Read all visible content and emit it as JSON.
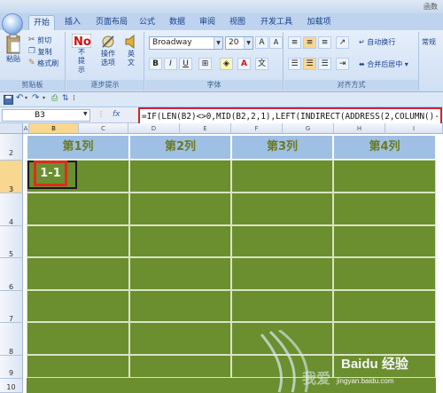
{
  "window": {
    "title_right": "函数"
  },
  "tabs": [
    {
      "label": "开始"
    },
    {
      "label": "插入"
    },
    {
      "label": "页面布局"
    },
    {
      "label": "公式"
    },
    {
      "label": "数据"
    },
    {
      "label": "审阅"
    },
    {
      "label": "视图"
    },
    {
      "label": "开发工具"
    },
    {
      "label": "加载项"
    }
  ],
  "ribbon": {
    "clipboard": {
      "paste": "粘贴",
      "cut": "剪切",
      "copy": "复制",
      "format_painter": "格式刷",
      "group": "剪贴板"
    },
    "steps": {
      "no_prompt": "不提示",
      "operate_options": "操作选项",
      "english": "英文",
      "group": "逐步提示"
    },
    "font": {
      "name": "Broadway",
      "size": "20",
      "group": "字体"
    },
    "alignment": {
      "wrap": "自动换行",
      "merge": "合并后居中",
      "group": "对齐方式"
    },
    "number": {
      "general": "常规"
    }
  },
  "namebox": "B3",
  "formula": "=IF(LEN(B2)<>0,MID(B2,2,1),LEFT(INDIRECT(ADDRESS(2,COLUMN()-1,4)",
  "columns": [
    "A",
    "B",
    "C",
    "D",
    "E",
    "F",
    "G",
    "H",
    "I"
  ],
  "rows": [
    "2",
    "3",
    "4",
    "5",
    "6",
    "7",
    "8",
    "9",
    "10"
  ],
  "headers": [
    "第1列",
    "第2列",
    "第3列",
    "第4列"
  ],
  "cell_b3": "1-1",
  "watermark": {
    "brand": "Baidu 经验",
    "url": "jingyan.baidu.com"
  },
  "colors": {
    "grid_fill": "#6b8e2f",
    "header_fill": "#9fc0e4",
    "highlight": "#e12a1f"
  }
}
